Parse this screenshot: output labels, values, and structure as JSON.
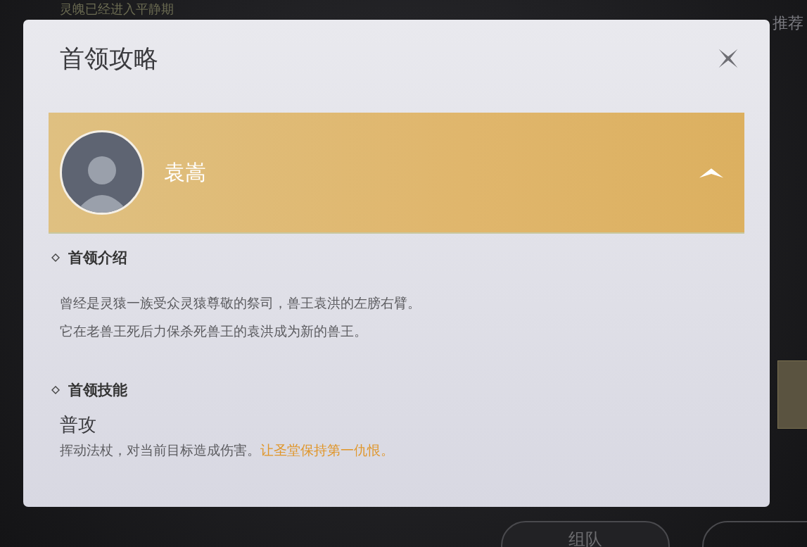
{
  "background": {
    "status_text": "灵魄已经进入平静期",
    "side_label": "推荐",
    "buttons": [
      "组队"
    ]
  },
  "dialog": {
    "title": "首领攻略",
    "boss": {
      "name": "袁嵩",
      "expanded": true
    },
    "sections": [
      {
        "kind": "intro",
        "heading": "首领介绍",
        "lines": [
          "曾经是灵猿一族受众灵猿尊敬的祭司，兽王袁洪的左膀右臂。",
          "它在老兽王死后力保杀死兽王的袁洪成为新的兽王。"
        ]
      },
      {
        "kind": "skills",
        "heading": "首领技能",
        "skills": [
          {
            "name": "普攻",
            "description": "挥动法杖，对当前目标造成伤害。",
            "highlight": "让圣堂保持第一仇恨。"
          }
        ]
      }
    ]
  }
}
